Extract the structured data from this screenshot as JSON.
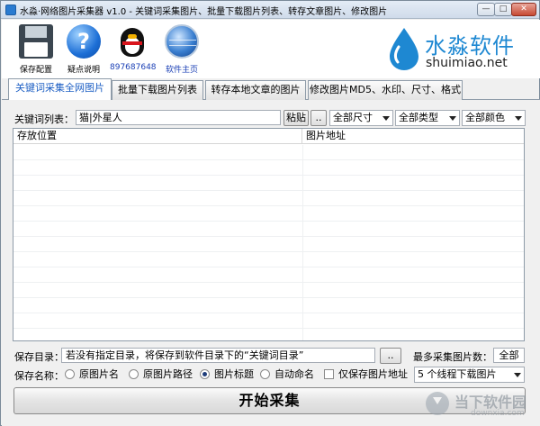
{
  "window": {
    "title": "水淼·网络图片采集器 v1.0 - 关键词采集图片、批量下载图片列表、转存文章图片、修改图片",
    "min_glyph": "—",
    "max_glyph": "□",
    "close_glyph": "✕"
  },
  "toolbar": {
    "save_label": "保存配置",
    "help_label": "疑点说明",
    "qq_label": "897687648",
    "home_label": "软件主页"
  },
  "brand": {
    "cn": "水淼软件",
    "en": "shuimiao.net",
    "accent": "#1e88d2"
  },
  "tabs": [
    {
      "label": "关键词采集全网图片",
      "active": true
    },
    {
      "label": "批量下载图片列表"
    },
    {
      "label": "转存本地文章的图片"
    },
    {
      "label": "修改图片MD5、水印、尺寸、格式"
    }
  ],
  "keywords": {
    "label": "关键词列表：",
    "value": "猫|外星人",
    "paste_label": "粘贴",
    "browse_label": ".."
  },
  "filters": {
    "size": "全部尺寸",
    "type": "全部类型",
    "color": "全部颜色"
  },
  "grid": {
    "columns": [
      "存放位置",
      "图片地址"
    ],
    "rows": []
  },
  "save_dir": {
    "label": "保存目录：",
    "value": "若没有指定目录，将保存到软件目录下的“关键词目录”",
    "browse_label": "..",
    "max_label": "最多采集图片数：",
    "max_value": "全部"
  },
  "naming": {
    "label": "保存名称：",
    "options": [
      {
        "label": "原图片名",
        "checked": false
      },
      {
        "label": "原图片路径",
        "checked": false
      },
      {
        "label": "图片标题",
        "checked": true
      },
      {
        "label": "自动命名",
        "checked": false
      }
    ],
    "only_address_label": "仅保存图片地址",
    "only_address_checked": false,
    "threads": "5 个线程下载图片"
  },
  "start_label": "开始采集",
  "watermark": {
    "cn": "当下软件园",
    "en": "downxia.com"
  }
}
